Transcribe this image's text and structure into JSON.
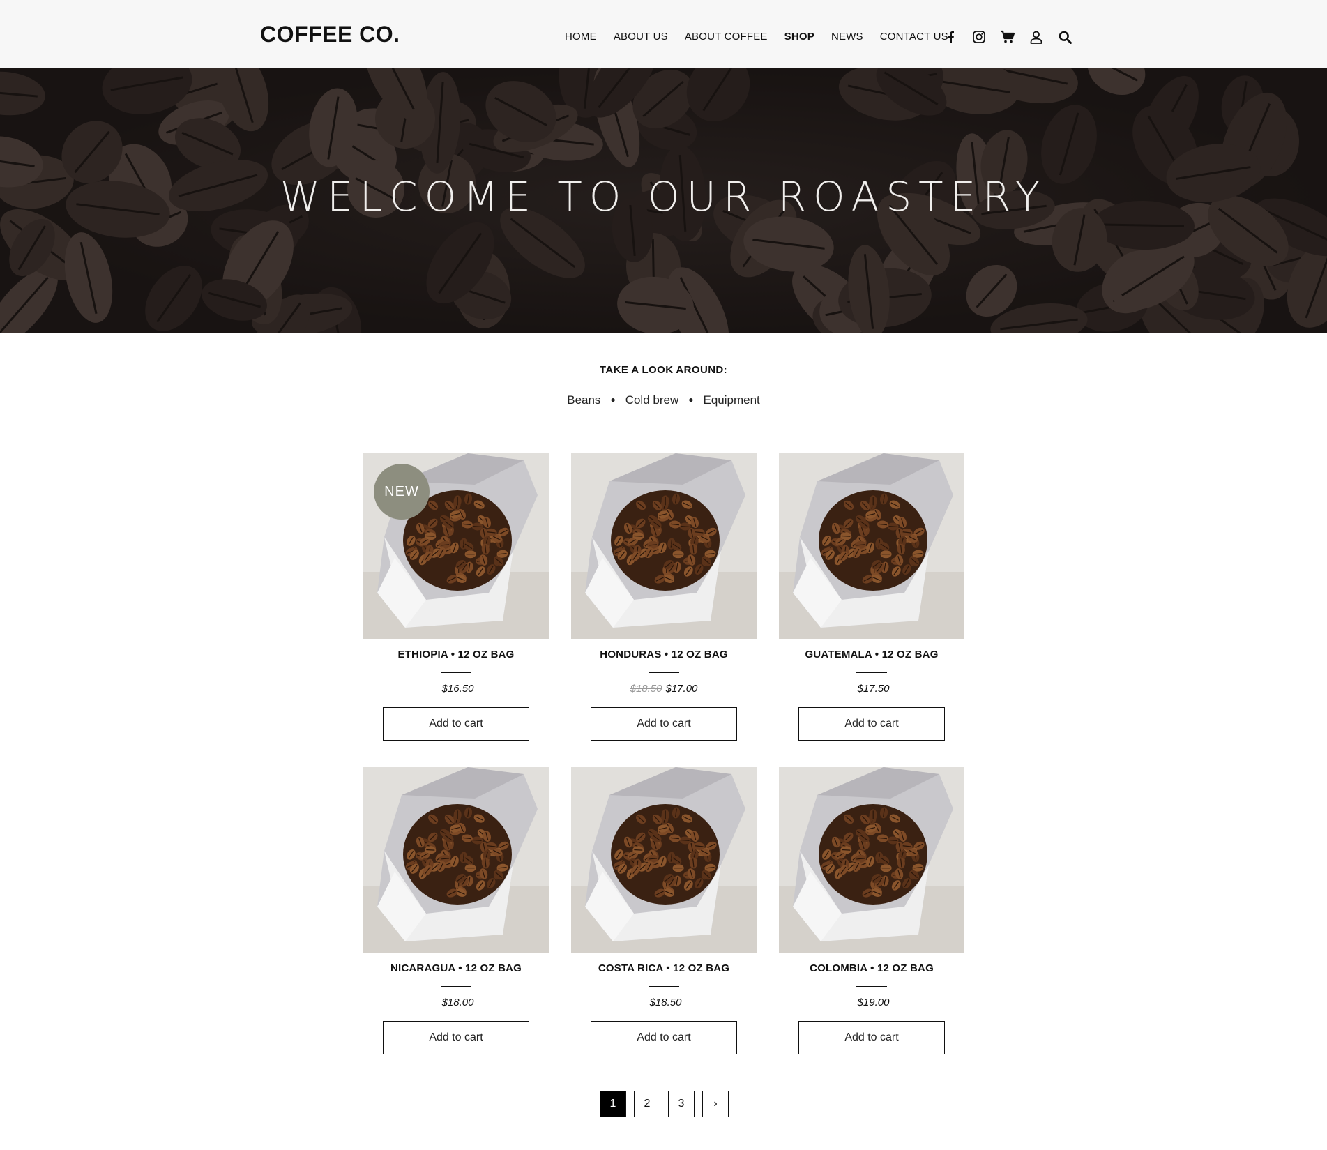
{
  "brand": "COFFEE CO.",
  "nav": [
    {
      "label": "HOME",
      "active": false
    },
    {
      "label": "ABOUT US",
      "active": false
    },
    {
      "label": "ABOUT COFFEE",
      "active": false
    },
    {
      "label": "SHOP",
      "active": true
    },
    {
      "label": "NEWS",
      "active": false
    },
    {
      "label": "CONTACT US",
      "active": false
    }
  ],
  "nav_icons": [
    "facebook-icon",
    "instagram-icon",
    "cart-icon",
    "account-icon",
    "search-icon"
  ],
  "hero": {
    "title": "WELCOME TO OUR ROASTERY"
  },
  "filter": {
    "heading": "TAKE A LOOK AROUND:",
    "categories": [
      "Beans",
      "Cold brew",
      "Equipment"
    ]
  },
  "products": [
    {
      "name": "ETHIOPIA • 12 OZ BAG",
      "price": "$16.50",
      "old_price": "",
      "badge": "NEW",
      "button": "Add to cart"
    },
    {
      "name": "HONDURAS • 12 OZ BAG",
      "price": "$17.00",
      "old_price": "$18.50",
      "badge": "",
      "button": "Add to cart"
    },
    {
      "name": "GUATEMALA • 12 OZ BAG",
      "price": "$17.50",
      "old_price": "",
      "badge": "",
      "button": "Add to cart"
    },
    {
      "name": "NICARAGUA • 12 OZ BAG",
      "price": "$18.00",
      "old_price": "",
      "badge": "",
      "button": "Add to cart"
    },
    {
      "name": "COSTA RICA • 12 OZ BAG",
      "price": "$18.50",
      "old_price": "",
      "badge": "",
      "button": "Add to cart"
    },
    {
      "name": "COLOMBIA • 12 OZ BAG",
      "price": "$19.00",
      "old_price": "",
      "badge": "",
      "button": "Add to cart"
    }
  ],
  "pagination": {
    "pages": [
      "1",
      "2",
      "3"
    ],
    "current": "1",
    "next": "›"
  },
  "colors": {
    "badge": "#8d8e7f",
    "hero_bg": "#1b1614",
    "header_bg": "#f7f7f7",
    "accent": "#000000"
  }
}
